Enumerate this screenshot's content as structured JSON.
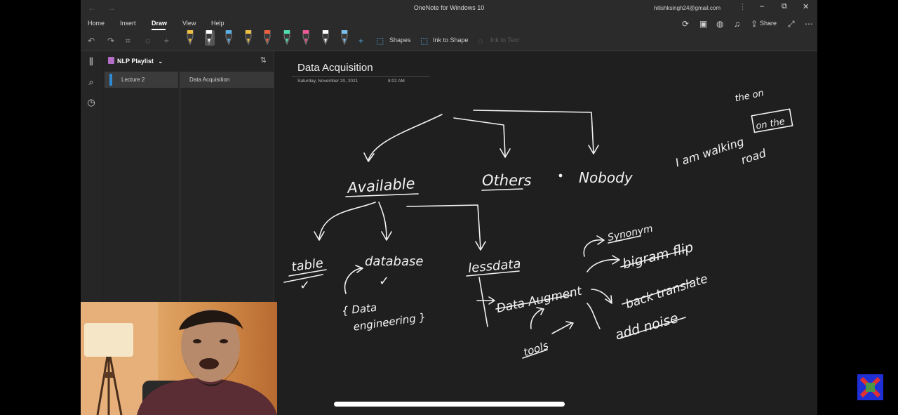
{
  "titlebar": {
    "app_title": "OneNote for Windows 10",
    "account": "nitishksingh24@gmail.com"
  },
  "ribbon": {
    "tabs": [
      {
        "label": "Home",
        "active": false
      },
      {
        "label": "Insert",
        "active": false
      },
      {
        "label": "Draw",
        "active": true
      },
      {
        "label": "View",
        "active": false
      },
      {
        "label": "Help",
        "active": false
      }
    ],
    "shapes_label": "Shapes",
    "ink_to_shape_label": "Ink to Shape",
    "ink_to_text_label": "Ink to Text",
    "share_label": "Share",
    "pen_colors": [
      "#f0c040",
      "#ffffff",
      "#5ab0e8",
      "#f0c040",
      "#f06040",
      "#50e0b0",
      "#f05a9a",
      "#ffffff",
      "#7ac0f0"
    ]
  },
  "nav": {
    "notebook": "NLP Playlist",
    "section": "Lecture 2",
    "page": "Data Acquisition"
  },
  "page": {
    "title": "Data Acquisition",
    "date": "Saturday, November 20, 2021",
    "time": "8:02 AM"
  },
  "ink": {
    "available": "Available",
    "others": "Others",
    "nobody": "Nobody",
    "table": "table",
    "database": "database",
    "lessdata": "lessdata",
    "data_engineering_1": "{ Data",
    "data_engineering_2": "engineering }",
    "data_augment": "Data Augment",
    "synonym": "Synonym",
    "bigram_flip": "bigram flip",
    "back_translate": "back translate",
    "add_noise": "add noise",
    "tools": "tools",
    "sentence_top": "the on",
    "sentence_main": "I am walking",
    "sentence_box": "on the",
    "sentence_road": "road",
    "check_table": "✓",
    "check_database": "✓"
  }
}
